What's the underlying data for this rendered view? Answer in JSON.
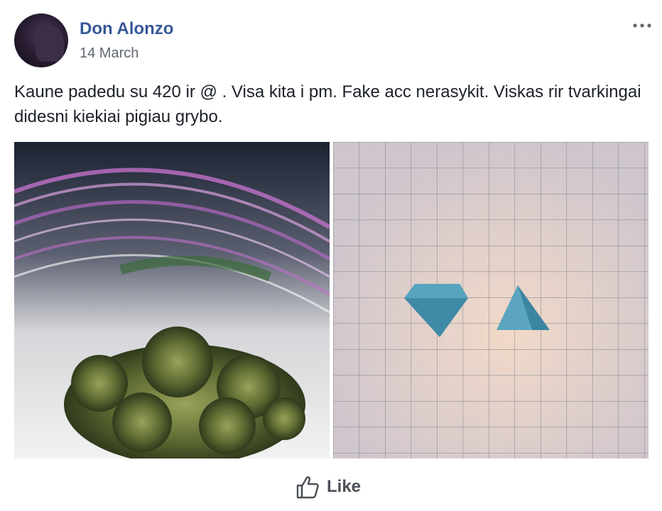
{
  "post": {
    "author_name": "Don Alonzo",
    "date": "14 March",
    "text": "Kaune padedu su 420 ir @ . Visa kita i pm. Fake acc nerasykit. Viskas rir tvarkingai didesni kiekiai pigiau grybo.",
    "more_icon": "ellipsis-icon",
    "photos": [
      {
        "description_icon": "photo-cannabis-bag"
      },
      {
        "description_icon": "photo-blue-pills-grid"
      }
    ]
  },
  "actions": {
    "like_label": "Like",
    "like_icon": "thumbs-up-icon"
  },
  "colors": {
    "author_link": "#365899",
    "secondary_text": "#616770",
    "body_text": "#1d2129",
    "action_text": "#4b4f56"
  }
}
